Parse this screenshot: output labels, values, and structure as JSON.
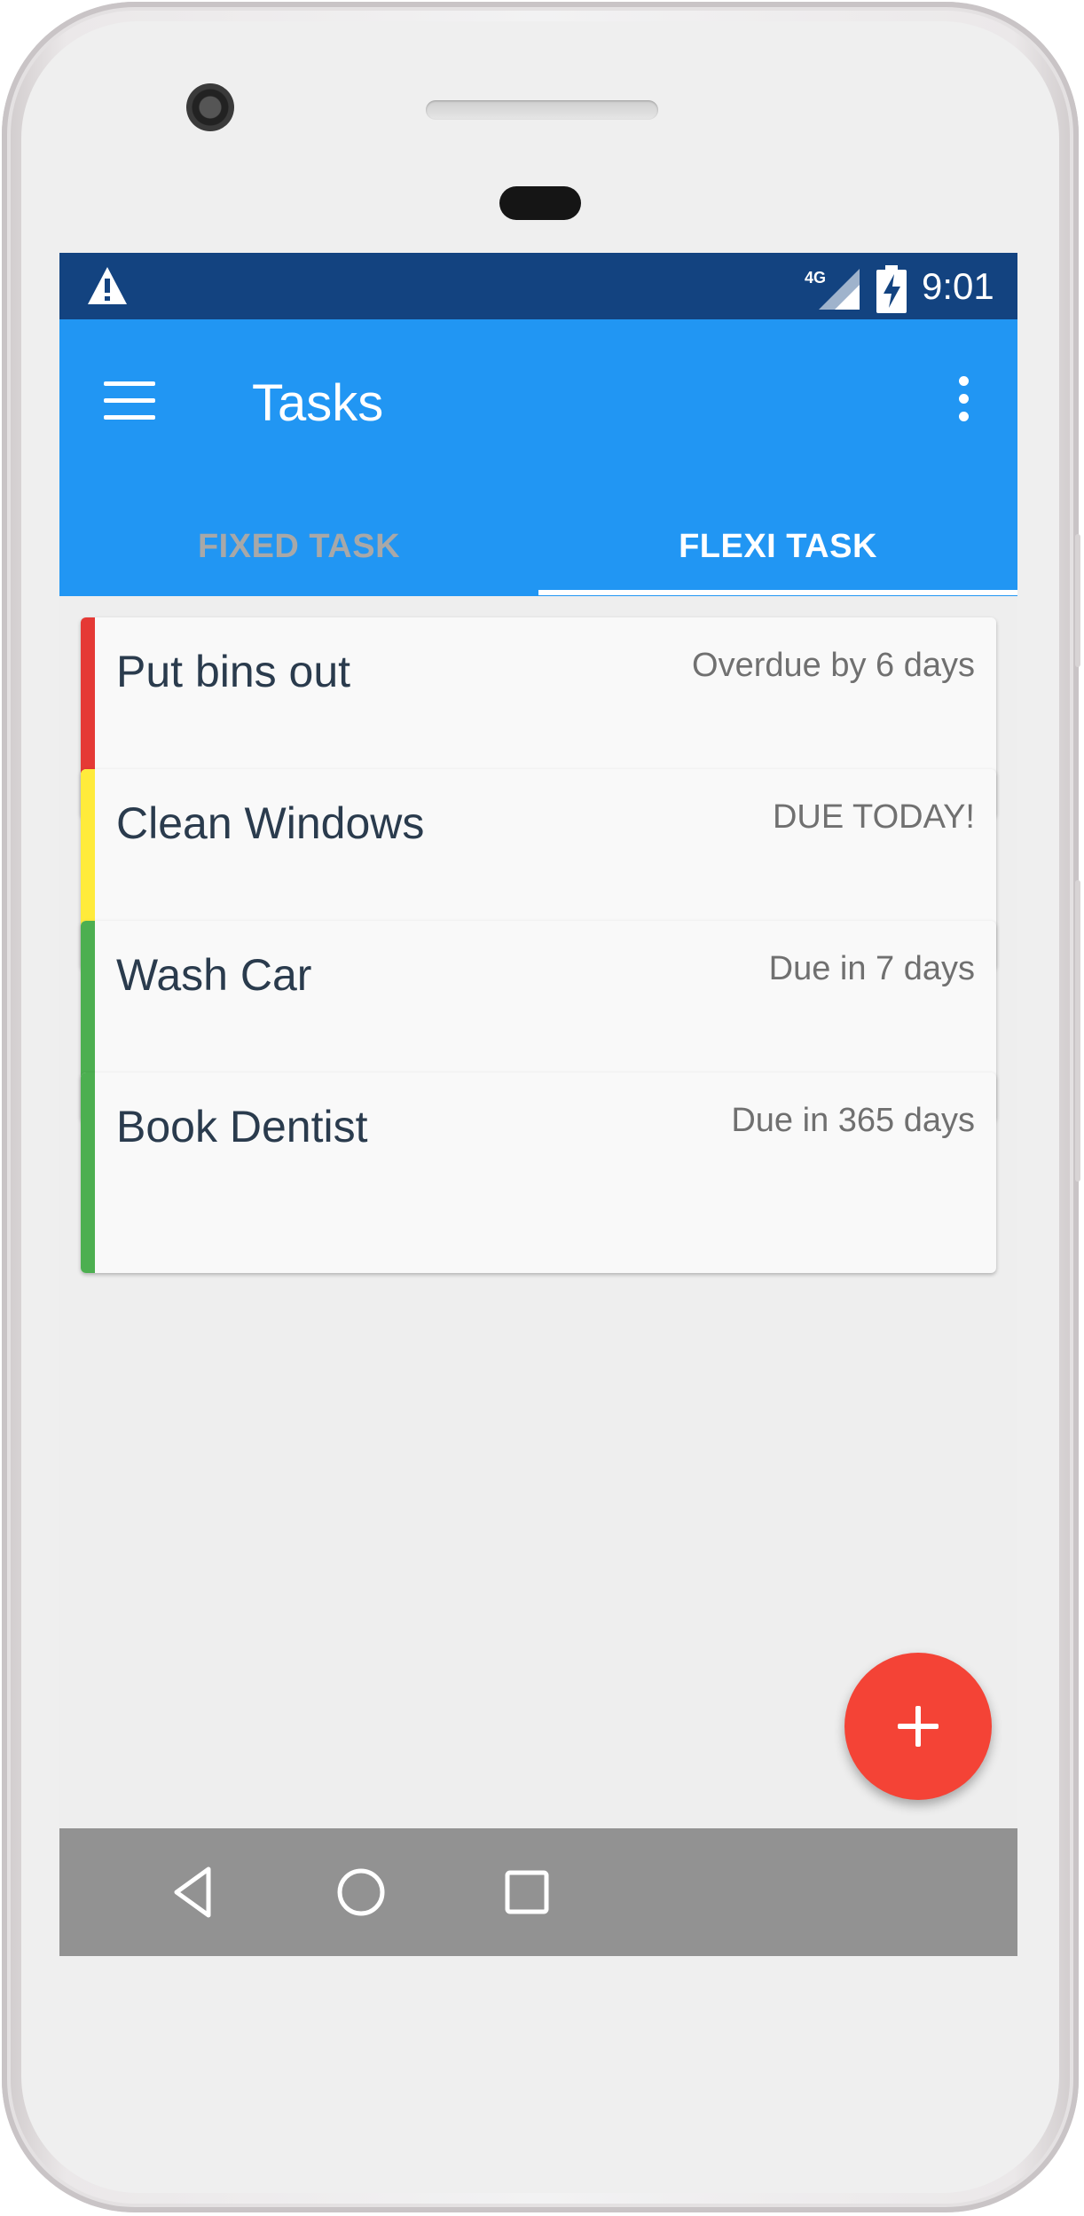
{
  "status_bar": {
    "time": "9:01",
    "network": "4G",
    "icons": [
      "warning-icon",
      "signal-icon",
      "battery-charging-icon"
    ]
  },
  "app_bar": {
    "title": "Tasks",
    "menu_icon": "hamburger-menu-icon",
    "overflow_icon": "more-vertical-icon"
  },
  "tabs": [
    {
      "label": "FIXED TASK",
      "active": false
    },
    {
      "label": "FLEXI TASK",
      "active": true
    }
  ],
  "tasks": [
    {
      "title": "Put bins out",
      "due": "Overdue by 6 days",
      "color": "#e53935"
    },
    {
      "title": "Clean Windows",
      "due": "DUE TODAY!",
      "color": "#ffeb3b"
    },
    {
      "title": "Wash Car",
      "due": "Due in 7 days",
      "color": "#4caf50"
    },
    {
      "title": "Book Dentist",
      "due": "Due in 365 days",
      "color": "#4caf50"
    }
  ],
  "fab": {
    "icon": "plus-icon",
    "color": "#f44336"
  },
  "nav_bar": {
    "icons": [
      "back-icon",
      "home-icon",
      "recents-icon"
    ]
  },
  "colors": {
    "status_bar": "#134380",
    "app_bar": "#2196f3",
    "background": "#eeeeee",
    "nav_bar": "#929292"
  }
}
